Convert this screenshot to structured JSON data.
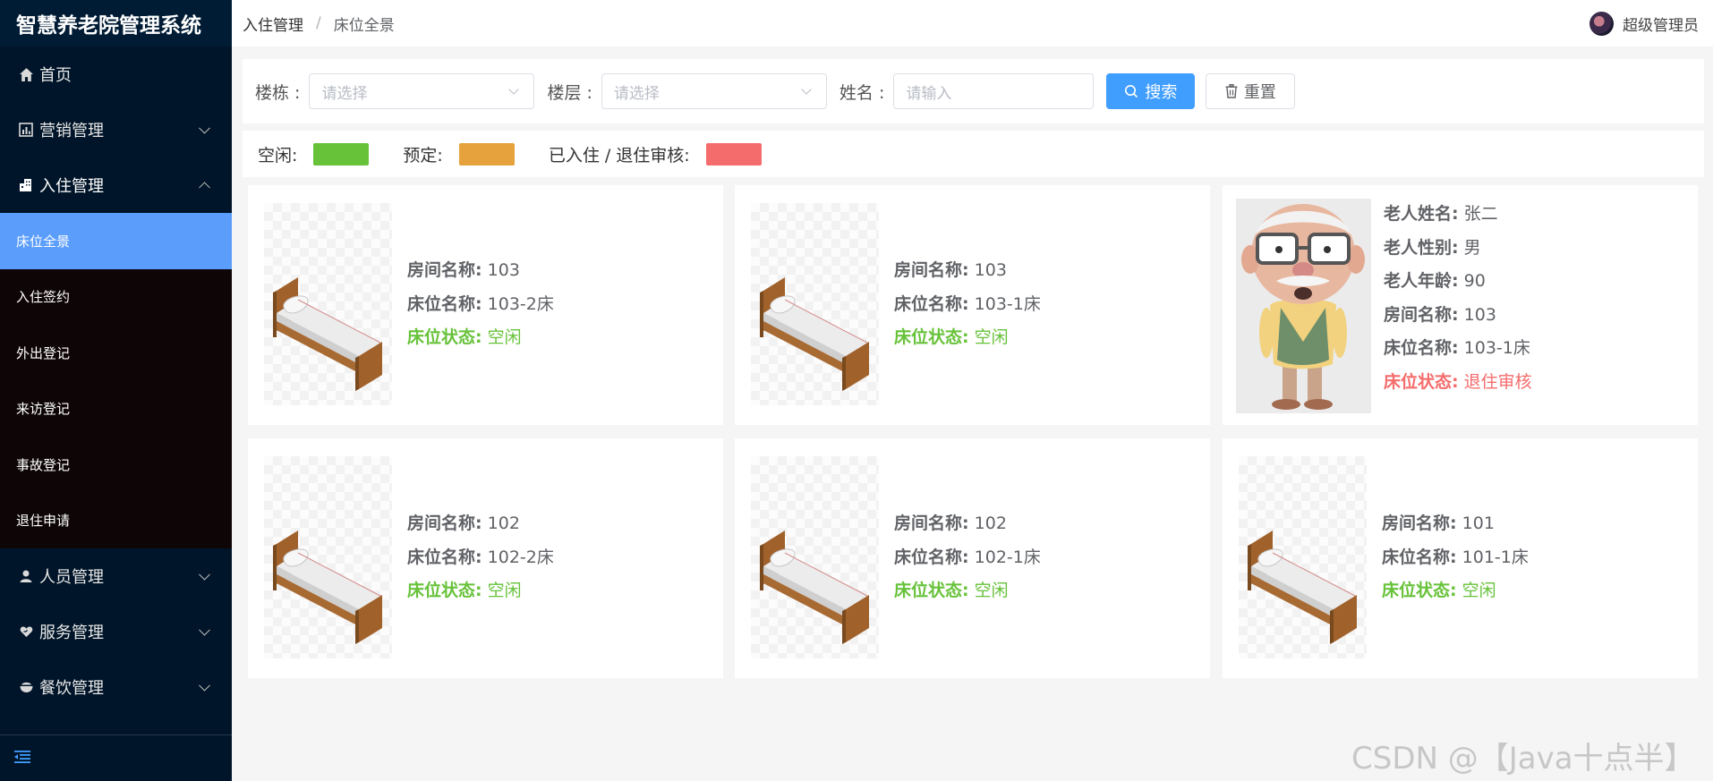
{
  "app": {
    "title": "智慧养老院管理系统"
  },
  "sidebar": {
    "items": [
      {
        "label": "首页",
        "icon": "home-icon"
      },
      {
        "label": "营销管理",
        "icon": "chart-icon"
      },
      {
        "label": "入住管理",
        "icon": "building-icon"
      },
      {
        "label": "人员管理",
        "icon": "user-icon"
      },
      {
        "label": "服务管理",
        "icon": "heart-hand-icon"
      },
      {
        "label": "餐饮管理",
        "icon": "bowl-icon"
      }
    ],
    "submenu": [
      "床位全景",
      "入住签约",
      "外出登记",
      "来访登记",
      "事故登记",
      "退住申请"
    ],
    "active_sub": "床位全景"
  },
  "breadcrumb": {
    "parent": "入住管理",
    "sep": "/",
    "current": "床位全景"
  },
  "user": {
    "name": "超级管理员"
  },
  "search": {
    "building_label": "楼栋 :",
    "building_placeholder": "请选择",
    "floor_label": "楼层 :",
    "floor_placeholder": "请选择",
    "name_label": "姓名 :",
    "name_placeholder": "请输入",
    "search_button": "搜索",
    "reset_button": "重置"
  },
  "legend": {
    "free_label": "空闲:",
    "reserved_label": "预定:",
    "occupied_label": "已入住 / 退住审核:",
    "colors": {
      "free": "#67c23a",
      "reserved": "#e6a23c",
      "occupied": "#f56c6c"
    }
  },
  "labels": {
    "room": "房间名称:",
    "bed": "床位名称:",
    "status": "床位状态:",
    "elder_name": "老人姓名:",
    "elder_gender": "老人性别:",
    "elder_age": "老人年龄:"
  },
  "cards": [
    {
      "room": "103",
      "bed": "103-2床",
      "status": "空闲"
    },
    {
      "room": "103",
      "bed": "103-1床",
      "status": "空闲"
    },
    {
      "elder_name": "张二",
      "elder_gender": "男",
      "elder_age": "90",
      "room": "103",
      "bed": "103-1床",
      "status": "退住审核"
    },
    {
      "room": "102",
      "bed": "102-2床",
      "status": "空闲"
    },
    {
      "room": "102",
      "bed": "102-1床",
      "status": "空闲"
    },
    {
      "room": "101",
      "bed": "101-1床",
      "status": "空闲"
    }
  ],
  "watermark": "CSDN @【Java十点半】"
}
